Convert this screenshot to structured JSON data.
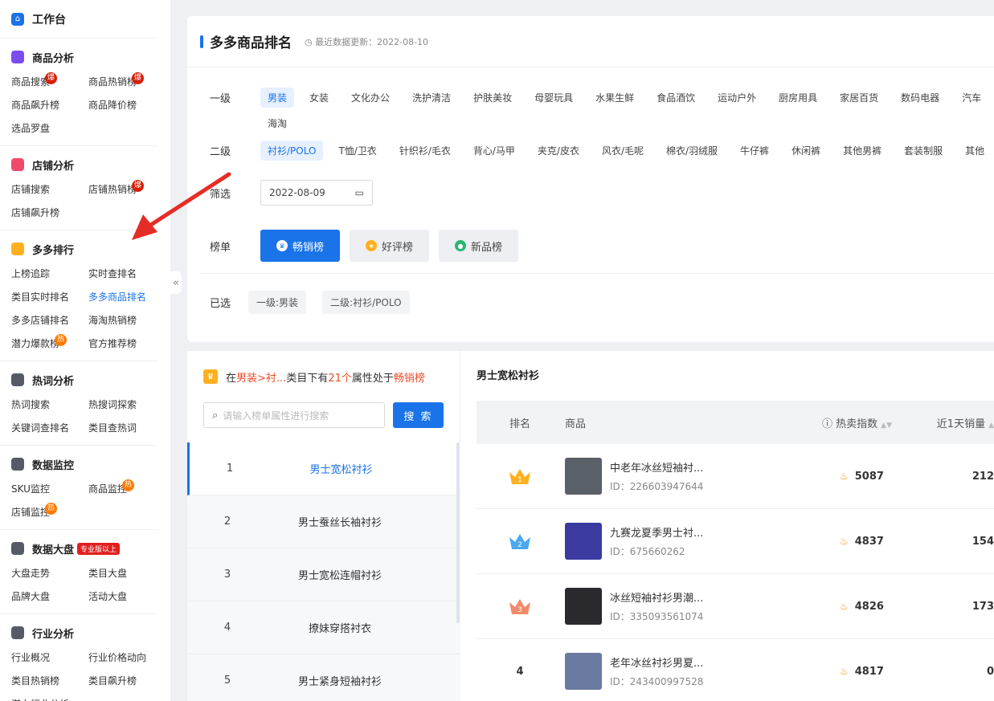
{
  "sidebar": {
    "workbench_label": "工作台",
    "sections": [
      {
        "title": "商品分析",
        "icon": "bag-icon",
        "color": "#7b4cf0",
        "items": [
          {
            "label": "商品搜索",
            "badge": "爆"
          },
          {
            "label": "商品热销榜",
            "badge": "爆"
          },
          {
            "label": "商品飙升榜"
          },
          {
            "label": "商品降价榜"
          },
          {
            "label": "选品罗盘"
          }
        ]
      },
      {
        "title": "店铺分析",
        "icon": "shop-icon",
        "color": "#f04a6a",
        "items": [
          {
            "label": "店铺搜索"
          },
          {
            "label": "店铺热销榜",
            "badge": "爆"
          },
          {
            "label": "店铺飙升榜"
          }
        ]
      },
      {
        "title": "多多排行",
        "icon": "podium-icon",
        "color": "#ffb020",
        "items": [
          {
            "label": "上榜追踪"
          },
          {
            "label": "实时查排名"
          },
          {
            "label": "类目实时排名"
          },
          {
            "label": "多多商品排名",
            "active": true
          },
          {
            "label": "多多店铺排名"
          },
          {
            "label": "海淘热销榜"
          },
          {
            "label": "潜力爆款榜",
            "badge": "热"
          },
          {
            "label": "官方推荐榜"
          }
        ]
      },
      {
        "title": "热词分析",
        "icon": "text-icon",
        "color": "#555a66",
        "items": [
          {
            "label": "热词搜索"
          },
          {
            "label": "热搜词探索"
          },
          {
            "label": "关键词查排名"
          },
          {
            "label": "类目查热词"
          }
        ]
      },
      {
        "title": "数据监控",
        "icon": "monitor-icon",
        "color": "#555a66",
        "items": [
          {
            "label": "SKU监控"
          },
          {
            "label": "商品监控",
            "badge": "热"
          },
          {
            "label": "店铺监控",
            "badge": "热"
          }
        ]
      },
      {
        "title": "数据大盘",
        "icon": "dashboard-icon",
        "color": "#555a66",
        "tag": "专业版以上",
        "items": [
          {
            "label": "大盘走势"
          },
          {
            "label": "类目大盘"
          },
          {
            "label": "品牌大盘"
          },
          {
            "label": "活动大盘"
          }
        ]
      },
      {
        "title": "行业分析",
        "icon": "industry-icon",
        "color": "#555a66",
        "items": [
          {
            "label": "行业概况"
          },
          {
            "label": "行业价格动向"
          },
          {
            "label": "类目热销榜"
          },
          {
            "label": "类目飙升榜"
          },
          {
            "label": "潜力行业分析"
          }
        ]
      }
    ]
  },
  "page": {
    "title": "多多商品排名",
    "updated": "最近数据更新：2022-08-10"
  },
  "filters": {
    "level1_label": "一级",
    "level1": [
      "男装",
      "女装",
      "文化办公",
      "洗护清洁",
      "护肤美妆",
      "母婴玩具",
      "水果生鲜",
      "食品酒饮",
      "运动户外",
      "厨房用具",
      "家居百货",
      "数码电器",
      "汽车"
    ],
    "level1_extra": "海淘",
    "level2_label": "二级",
    "level2": [
      "衬衫/POLO",
      "T恤/卫衣",
      "针织衫/毛衣",
      "背心/马甲",
      "夹克/皮衣",
      "风衣/毛呢",
      "棉衣/羽绒服",
      "牛仔裤",
      "休闲裤",
      "其他男裤",
      "套装制服",
      "其他"
    ],
    "filter_label": "筛选",
    "date": "2022-08-09",
    "board_label": "榜单",
    "boards": [
      "畅销榜",
      "好评榜",
      "新品榜"
    ],
    "selected_label": "已选",
    "selected": [
      "一级:男装",
      "二级:衬衫/POLO"
    ]
  },
  "keywords": {
    "info_prefix": "在",
    "info_cat": "男装>衬...",
    "info_mid": " 类目下有",
    "info_count": "21个",
    "info_mid2": "属性处于",
    "info_board": "畅销榜",
    "search_placeholder": "请输入榜单属性进行搜索",
    "search_button": "搜 索",
    "list": [
      {
        "n": "1",
        "k": "男士宽松衬衫"
      },
      {
        "n": "2",
        "k": "男士蚕丝长袖衬衫"
      },
      {
        "n": "3",
        "k": "男士宽松连帽衬衫"
      },
      {
        "n": "4",
        "k": "撩妹穿搭衬衣"
      },
      {
        "n": "5",
        "k": "男士紧身短袖衬衫"
      }
    ]
  },
  "table": {
    "title": "男士宽松衬衫",
    "headers": {
      "rank": "排名",
      "product": "商品",
      "hot": "热卖指数",
      "sales": "近1天销量"
    },
    "rows": [
      {
        "rank": "1",
        "name": "中老年冰丝短袖衬...",
        "id": "ID：226603947644",
        "hot": "5087",
        "sales": "212",
        "crown": "#ffb020",
        "img": "#5a6068"
      },
      {
        "rank": "2",
        "name": "九赛龙夏季男士衬...",
        "id": "ID：675660262",
        "hot": "4837",
        "sales": "154",
        "crown": "#4aa8f0",
        "img": "#3a3aa0"
      },
      {
        "rank": "3",
        "name": "冰丝短袖衬衫男潮...",
        "id": "ID：335093561074",
        "hot": "4826",
        "sales": "173",
        "crown": "#f08a6a",
        "img": "#2a2a2e"
      },
      {
        "rank": "4",
        "name": "老年冰丝衬衫男夏...",
        "id": "ID：243400997528",
        "hot": "4817",
        "sales": "0",
        "crown": "",
        "img": "#6a7aa0"
      }
    ]
  }
}
